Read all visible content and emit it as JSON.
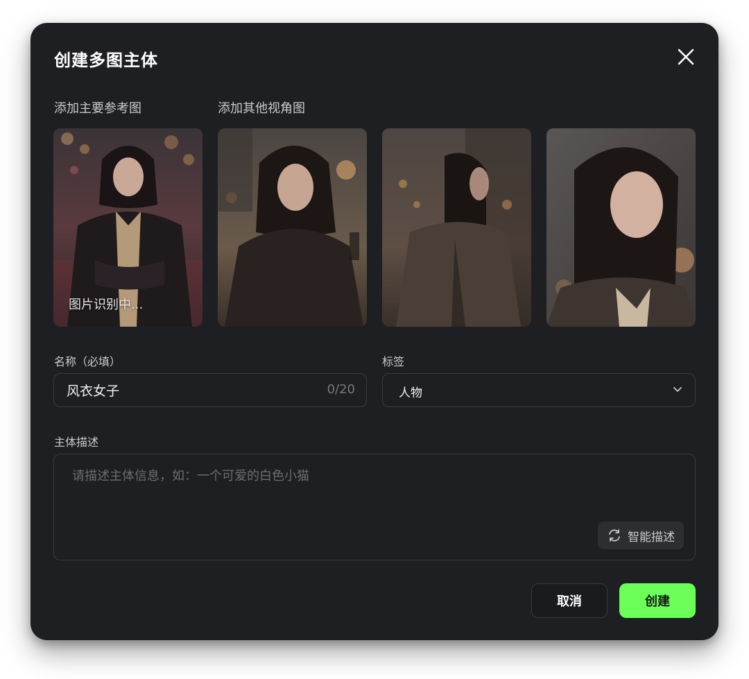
{
  "dialog": {
    "title": "创建多图主体",
    "close_icon": "close-icon"
  },
  "images": {
    "main_label": "添加主要参考图",
    "other_label": "添加其他视角图",
    "main_status": "图片识别中..."
  },
  "name_field": {
    "label": "名称（必填）",
    "value": "风衣女子",
    "counter": "0/20"
  },
  "tag_field": {
    "label": "标签",
    "value": "人物",
    "icon": "chevron-down-icon"
  },
  "description": {
    "label": "主体描述",
    "placeholder": "请描述主体信息，如：一个可爱的白色小猫",
    "smart_button_label": "智能描述",
    "smart_button_icon": "refresh-icon"
  },
  "actions": {
    "cancel_label": "取消",
    "create_label": "创建"
  },
  "colors": {
    "background": "#1e1f22",
    "accent": "#6cff5a",
    "border": "#3b3c40"
  }
}
